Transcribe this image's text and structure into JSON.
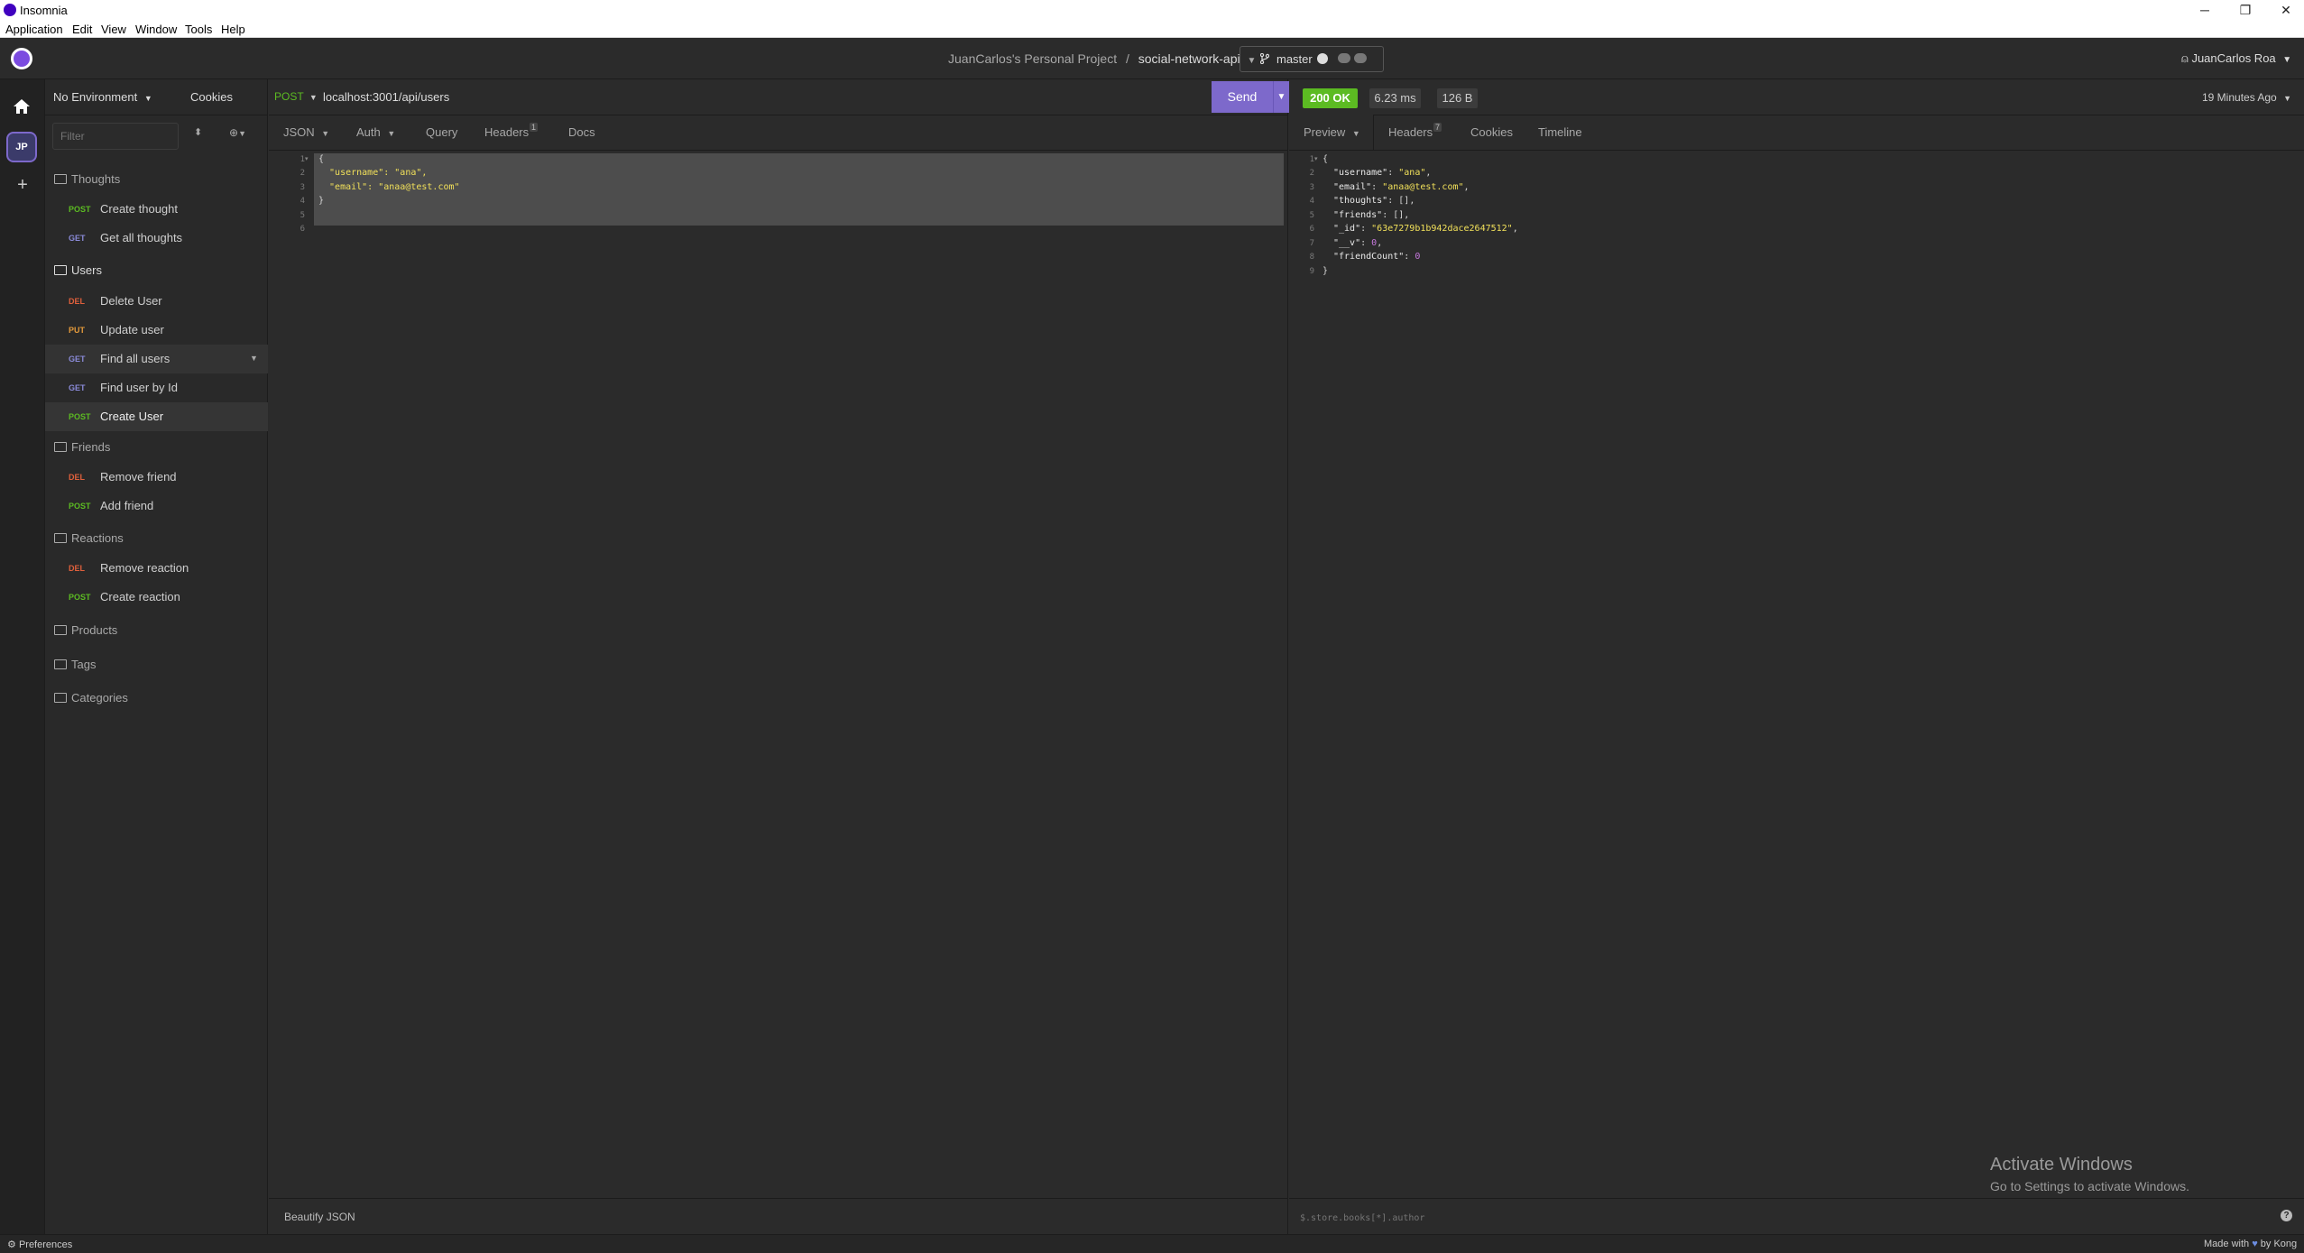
{
  "window": {
    "title": "Insomnia",
    "controls": [
      "─",
      "❐",
      "✕"
    ]
  },
  "menu": [
    "Application",
    "Edit",
    "View",
    "Window",
    "Tools",
    "Help"
  ],
  "header": {
    "project": "JuanCarlos's Personal Project",
    "separator": "/",
    "collection": "social-network-api",
    "branch": "master",
    "user": "JuanCarlos Roa"
  },
  "activity": {
    "avatar": "JP",
    "add": "+"
  },
  "sidebar": {
    "environment": "No Environment",
    "cookies": "Cookies",
    "filter_placeholder": "Filter",
    "folders": [
      {
        "name": "Thoughts",
        "items": [
          {
            "method": "POST",
            "name": "Create thought"
          },
          {
            "method": "GET",
            "name": "Get all thoughts"
          }
        ]
      },
      {
        "name": "Users",
        "items": [
          {
            "method": "DEL",
            "name": "Delete User"
          },
          {
            "method": "PUT",
            "name": "Update user"
          },
          {
            "method": "GET",
            "name": "Find all users"
          },
          {
            "method": "GET",
            "name": "Find user by Id"
          },
          {
            "method": "POST",
            "name": "Create User"
          }
        ]
      },
      {
        "name": "Friends",
        "items": [
          {
            "method": "DEL",
            "name": "Remove friend"
          },
          {
            "method": "POST",
            "name": "Add friend"
          }
        ]
      },
      {
        "name": "Reactions",
        "items": [
          {
            "method": "DEL",
            "name": "Remove reaction"
          },
          {
            "method": "POST",
            "name": "Create reaction"
          }
        ]
      },
      {
        "name": "Products",
        "items": []
      },
      {
        "name": "Tags",
        "items": []
      },
      {
        "name": "Categories",
        "items": []
      }
    ]
  },
  "request": {
    "method": "POST",
    "url": "localhost:3001/api/users",
    "send": "Send",
    "tabs": {
      "body": "JSON",
      "auth": "Auth",
      "query": "Query",
      "headers": "Headers",
      "headers_count": "1",
      "docs": "Docs"
    },
    "line_numbers": [
      "1",
      "2",
      "3",
      "4",
      "5",
      "6"
    ],
    "body_lines": [
      "{",
      "  \"username\": \"ana\",",
      "  \"email\": \"anaa@test.com\"",
      "}",
      "",
      ""
    ],
    "footer": "Beautify JSON"
  },
  "response": {
    "status": "200 OK",
    "time": "6.23 ms",
    "size": "126 B",
    "age": "19 Minutes Ago",
    "tabs": {
      "preview": "Preview",
      "headers": "Headers",
      "headers_count": "7",
      "cookies": "Cookies",
      "timeline": "Timeline"
    },
    "line_numbers": [
      "1",
      "2",
      "3",
      "4",
      "5",
      "6",
      "7",
      "8",
      "9"
    ],
    "json": {
      "open": "{",
      "username_key": "\"username\"",
      "username_val": "\"ana\"",
      "email_key": "\"email\"",
      "email_val": "\"anaa@test.com\"",
      "thoughts_key": "\"thoughts\"",
      "thoughts_val": "[]",
      "friends_key": "\"friends\"",
      "friends_val": "[]",
      "id_key": "\"_id\"",
      "id_val": "\"63e7279b1b942dace2647512\"",
      "v_key": "\"__v\"",
      "v_val": "0",
      "fc_key": "\"friendCount\"",
      "fc_val": "0",
      "close": "}"
    },
    "filter_placeholder": "$.store.books[*].author",
    "help": "?"
  },
  "watermark": {
    "title": "Activate Windows",
    "subtitle": "Go to Settings to activate Windows."
  },
  "statusbar": {
    "preferences": "Preferences",
    "made_with_prefix": "Made with",
    "made_with_suffix": "by Kong"
  },
  "colors": {
    "accent": "#7d69cb",
    "success": "#5cbb22",
    "post": "#5cbb22",
    "get": "#8a8ad8",
    "del": "#e0603c",
    "put": "#e49a3b"
  }
}
